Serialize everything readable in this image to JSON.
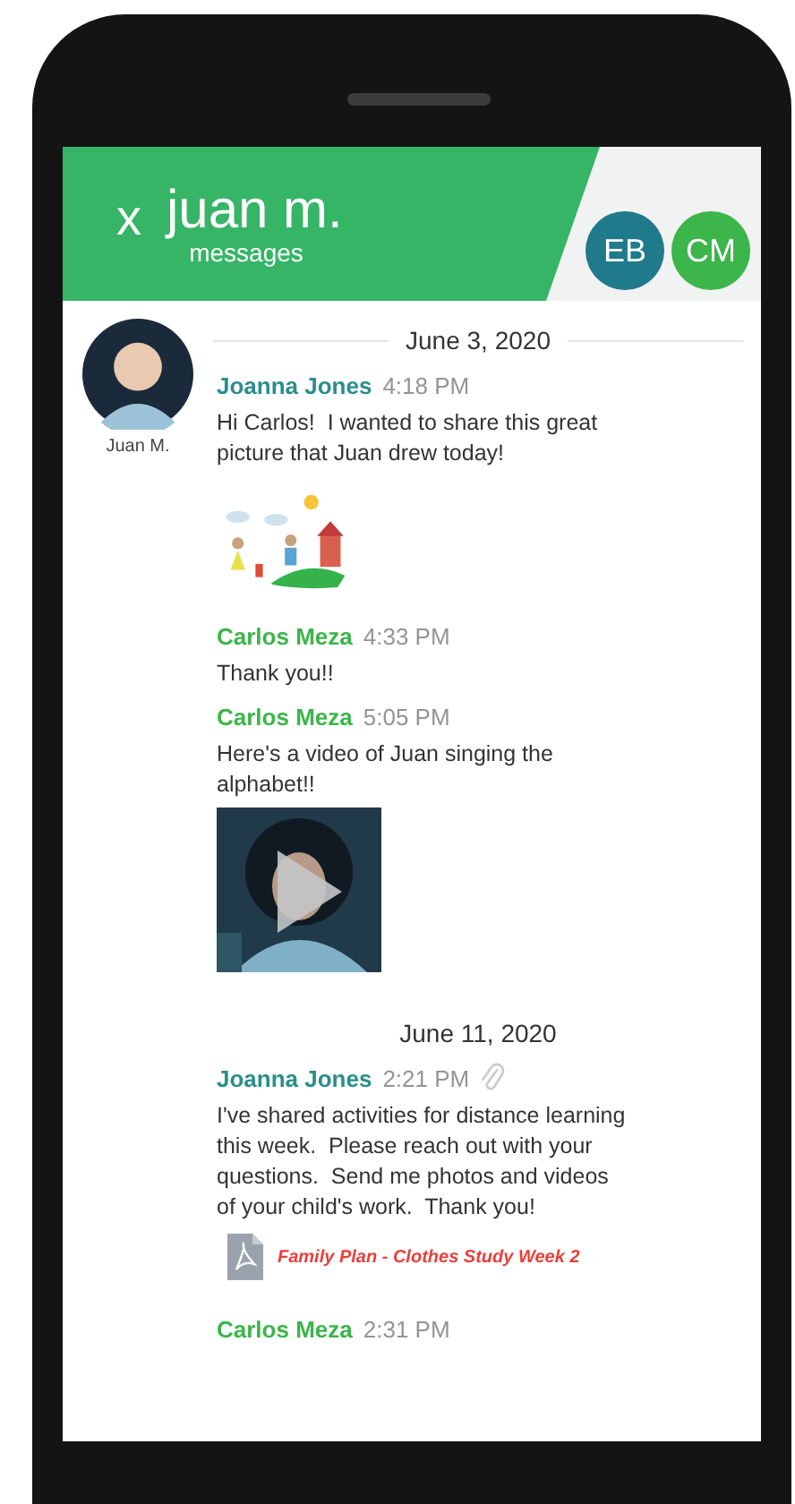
{
  "header": {
    "close": "x",
    "title": "juan m.",
    "subtitle": "messages",
    "participants": [
      {
        "initials": "EB",
        "color": "#1f7a8c"
      },
      {
        "initials": "CM",
        "color": "#3cb54a"
      }
    ]
  },
  "student": {
    "name": "Juan M."
  },
  "days": [
    {
      "date": "June 3, 2020",
      "messages": [
        {
          "sender": "Joanna Jones",
          "color": "#2a8f8c",
          "time": "4:18 PM",
          "has_attachment": false,
          "text": "Hi Carlos!  I wanted to share this great picture that Juan drew today!",
          "attachment": {
            "kind": "drawing"
          }
        },
        {
          "sender": "Carlos Meza",
          "color": "#3cb54a",
          "time": "4:33 PM",
          "has_attachment": false,
          "text": "Thank you!!"
        },
        {
          "sender": "Carlos Meza",
          "color": "#3cb54a",
          "time": "5:05 PM",
          "has_attachment": false,
          "text": "Here's a video of Juan singing the alphabet!!",
          "attachment": {
            "kind": "video"
          }
        }
      ]
    },
    {
      "date": "June 11, 2020",
      "messages": [
        {
          "sender": "Joanna Jones",
          "color": "#2a8f8c",
          "time": "2:21 PM",
          "has_attachment": true,
          "text": "I've shared activities for distance learning this week.  Please reach out with your questions.  Send me photos and videos of your child's work.  Thank you!",
          "attachment": {
            "kind": "file",
            "name": "Family Plan - Clothes Study Week 2"
          }
        },
        {
          "sender": "Carlos Meza",
          "color": "#3cb54a",
          "time": "2:31 PM",
          "has_attachment": false
        }
      ]
    }
  ]
}
